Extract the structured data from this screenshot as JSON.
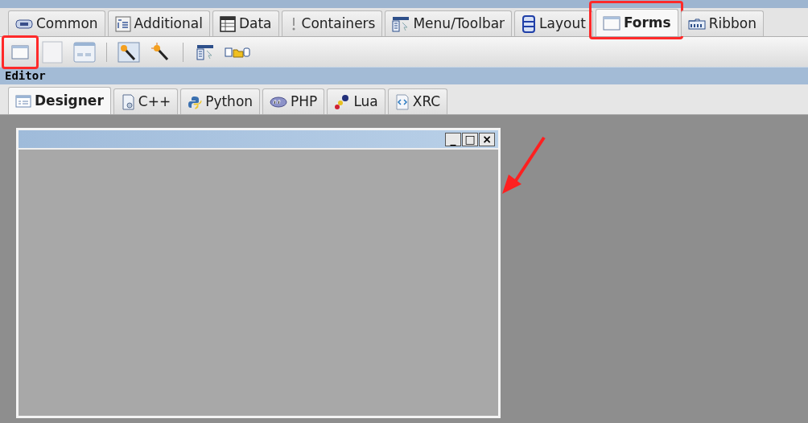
{
  "palette_tabs": [
    {
      "label": "Common",
      "selected": false,
      "highlighted": false
    },
    {
      "label": "Additional",
      "selected": false,
      "highlighted": false
    },
    {
      "label": "Data",
      "selected": false,
      "highlighted": false
    },
    {
      "label": "Containers",
      "selected": false,
      "highlighted": false
    },
    {
      "label": "Menu/Toolbar",
      "selected": false,
      "highlighted": false
    },
    {
      "label": "Layout",
      "selected": false,
      "highlighted": false
    },
    {
      "label": "Forms",
      "selected": true,
      "highlighted": true
    },
    {
      "label": "Ribbon",
      "selected": false,
      "highlighted": false
    }
  ],
  "toolbar": [
    {
      "kind": "button",
      "highlighted": true
    },
    {
      "kind": "button",
      "highlighted": false
    },
    {
      "kind": "button",
      "highlighted": false
    },
    {
      "kind": "separator"
    },
    {
      "kind": "button",
      "highlighted": false
    },
    {
      "kind": "button",
      "highlighted": false
    },
    {
      "kind": "separator"
    },
    {
      "kind": "button",
      "highlighted": false
    },
    {
      "kind": "button",
      "highlighted": false
    }
  ],
  "editor": {
    "title": "Editor",
    "tabs": [
      {
        "label": "Designer",
        "selected": true
      },
      {
        "label": "C++",
        "selected": false
      },
      {
        "label": "Python",
        "selected": false
      },
      {
        "label": "PHP",
        "selected": false
      },
      {
        "label": "Lua",
        "selected": false
      },
      {
        "label": "XRC",
        "selected": false
      }
    ],
    "form": {
      "title_buttons": [
        "_",
        "□",
        "×"
      ],
      "annotation_arrow": true
    }
  }
}
